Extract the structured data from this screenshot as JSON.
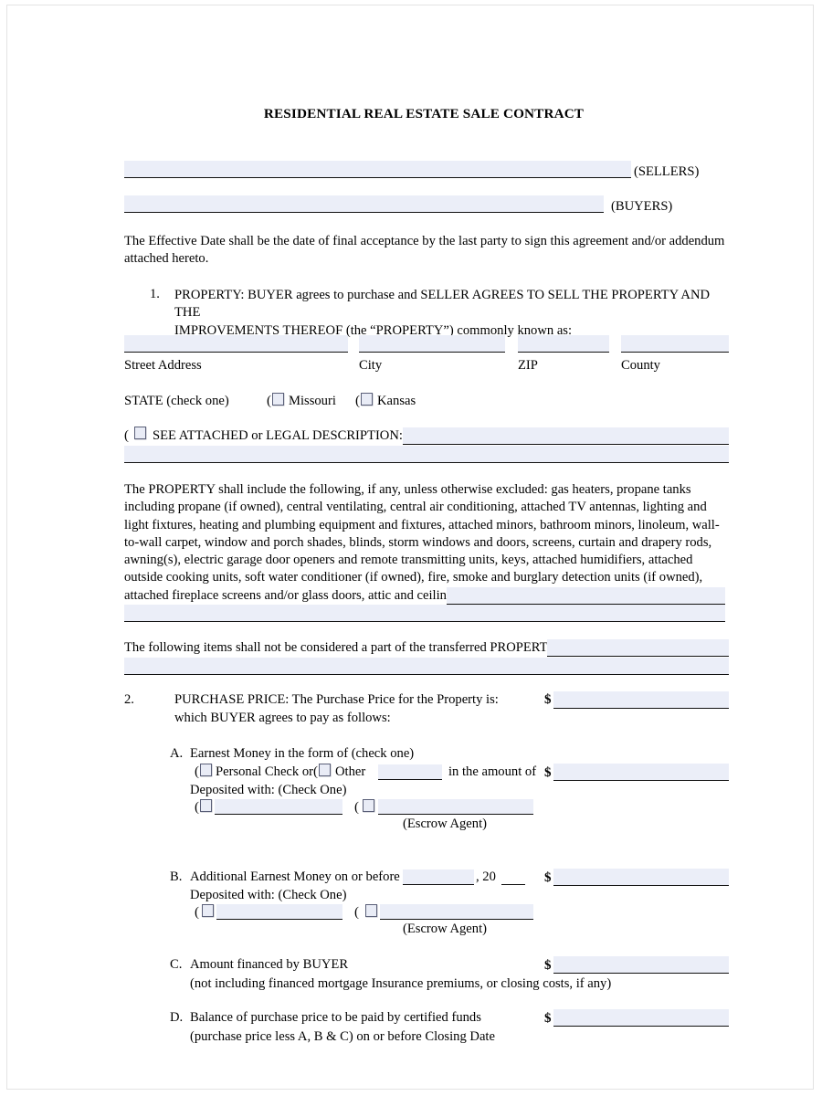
{
  "document": {
    "title": "RESIDENTIAL REAL ESTATE SALE CONTRACT",
    "sellers_label": "(SELLERS)",
    "buyers_label": "(BUYERS)",
    "effective_date_paragraph": "The Effective Date shall be the date of final acceptance by the last party to sign this agreement and/or addendum\nattached hereto."
  },
  "section1": {
    "number": "1.",
    "heading": "PROPERTY: BUYER agrees to purchase and SELLER AGREES TO SELL THE PROPERTY AND THE\nIMPROVEMENTS THEREOF (the “PROPERTY”) commonly known as:",
    "address_labels": {
      "street": "Street Address",
      "city": "City",
      "zip": "ZIP",
      "county": "County"
    },
    "state_label": "STATE (check one)",
    "state_options": [
      {
        "label": "Missouri"
      },
      {
        "label": "Kansas"
      }
    ],
    "legal_description_label": "SEE ATTACHED or LEGAL DESCRIPTION:",
    "included_items_paragraph": "The PROPERTY shall include the following, if any, unless otherwise excluded: gas heaters, propane tanks including propane (if owned), central ventilating, central air conditioning, attached TV antennas, lighting and light fixtures, heating and plumbing equipment and fixtures, attached minors, bathroom minors, linoleum, wall-to-wall carpet, window and porch shades, blinds, storm windows and doors, screens, curtain and drapery rods, awning(s), electric garage door openers and remote transmitting units, keys, attached humidifiers, attached outside cooking units, soft water conditioner (if owned), fire, smoke and burglary detection units (if owned), attached fireplace screens and/or glass doors, attic and ceiling fans, built-in appliances and:",
    "excluded_items_label": "The following items shall not be considered a part of the transferred PROPERTY:"
  },
  "section2": {
    "number": "2.",
    "heading_line1": "PURCHASE PRICE: The Purchase Price for the Property is:",
    "heading_line2": "which BUYER agrees to pay as follows:",
    "currency_symbol": "$",
    "items": [
      {
        "letter": "A.",
        "title": "Earnest Money in the form of (check one)",
        "option1_label": "Personal Check or",
        "option2_label": "Other",
        "amount_phrase": "in the amount of",
        "deposited_label": "Deposited with:  (Check One)",
        "escrow_agent_label": "(Escrow Agent)"
      },
      {
        "letter": "B.",
        "title_prefix": "Additional Earnest Money on or before",
        "title_suffix": ", 20",
        "deposited_label": "Deposited with:  (Check One)",
        "escrow_agent_label": "(Escrow Agent)"
      },
      {
        "letter": "C.",
        "title": "Amount financed by BUYER",
        "note": "(not including financed mortgage Insurance premiums, or closing costs, if any)"
      },
      {
        "letter": "D.",
        "title": "Balance of purchase price to be paid by certified funds",
        "note": "(purchase price less A, B & C) on or before Closing Date"
      }
    ]
  },
  "colors": {
    "field_fill": "#ebeef8",
    "rule": "#111111",
    "checkbox_border": "#5a5f78",
    "page_border": "#e3e3e3"
  }
}
